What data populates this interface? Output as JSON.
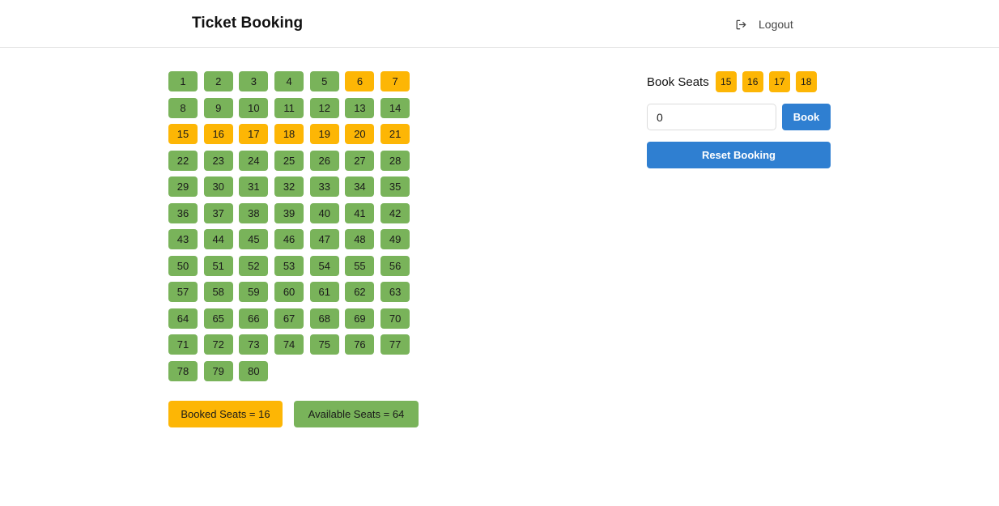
{
  "header": {
    "title": "Ticket Booking",
    "logout_label": "Logout",
    "logout_icon": "logout-icon"
  },
  "seats": [
    {
      "number": "1",
      "status": "available"
    },
    {
      "number": "2",
      "status": "available"
    },
    {
      "number": "3",
      "status": "available"
    },
    {
      "number": "4",
      "status": "available"
    },
    {
      "number": "5",
      "status": "available"
    },
    {
      "number": "6",
      "status": "booked"
    },
    {
      "number": "7",
      "status": "booked"
    },
    {
      "number": "8",
      "status": "available"
    },
    {
      "number": "9",
      "status": "available"
    },
    {
      "number": "10",
      "status": "available"
    },
    {
      "number": "11",
      "status": "available"
    },
    {
      "number": "12",
      "status": "available"
    },
    {
      "number": "13",
      "status": "available"
    },
    {
      "number": "14",
      "status": "available"
    },
    {
      "number": "15",
      "status": "booked"
    },
    {
      "number": "16",
      "status": "booked"
    },
    {
      "number": "17",
      "status": "booked"
    },
    {
      "number": "18",
      "status": "booked"
    },
    {
      "number": "19",
      "status": "booked"
    },
    {
      "number": "20",
      "status": "booked"
    },
    {
      "number": "21",
      "status": "booked"
    },
    {
      "number": "22",
      "status": "available"
    },
    {
      "number": "23",
      "status": "available"
    },
    {
      "number": "24",
      "status": "available"
    },
    {
      "number": "25",
      "status": "available"
    },
    {
      "number": "26",
      "status": "available"
    },
    {
      "number": "27",
      "status": "available"
    },
    {
      "number": "28",
      "status": "available"
    },
    {
      "number": "29",
      "status": "available"
    },
    {
      "number": "30",
      "status": "available"
    },
    {
      "number": "31",
      "status": "available"
    },
    {
      "number": "32",
      "status": "available"
    },
    {
      "number": "33",
      "status": "available"
    },
    {
      "number": "34",
      "status": "available"
    },
    {
      "number": "35",
      "status": "available"
    },
    {
      "number": "36",
      "status": "available"
    },
    {
      "number": "37",
      "status": "available"
    },
    {
      "number": "38",
      "status": "available"
    },
    {
      "number": "39",
      "status": "available"
    },
    {
      "number": "40",
      "status": "available"
    },
    {
      "number": "41",
      "status": "available"
    },
    {
      "number": "42",
      "status": "available"
    },
    {
      "number": "43",
      "status": "available"
    },
    {
      "number": "44",
      "status": "available"
    },
    {
      "number": "45",
      "status": "available"
    },
    {
      "number": "46",
      "status": "available"
    },
    {
      "number": "47",
      "status": "available"
    },
    {
      "number": "48",
      "status": "available"
    },
    {
      "number": "49",
      "status": "available"
    },
    {
      "number": "50",
      "status": "available"
    },
    {
      "number": "51",
      "status": "available"
    },
    {
      "number": "52",
      "status": "available"
    },
    {
      "number": "53",
      "status": "available"
    },
    {
      "number": "54",
      "status": "available"
    },
    {
      "number": "55",
      "status": "available"
    },
    {
      "number": "56",
      "status": "available"
    },
    {
      "number": "57",
      "status": "available"
    },
    {
      "number": "58",
      "status": "available"
    },
    {
      "number": "59",
      "status": "available"
    },
    {
      "number": "60",
      "status": "available"
    },
    {
      "number": "61",
      "status": "available"
    },
    {
      "number": "62",
      "status": "available"
    },
    {
      "number": "63",
      "status": "available"
    },
    {
      "number": "64",
      "status": "available"
    },
    {
      "number": "65",
      "status": "available"
    },
    {
      "number": "66",
      "status": "available"
    },
    {
      "number": "67",
      "status": "available"
    },
    {
      "number": "68",
      "status": "available"
    },
    {
      "number": "69",
      "status": "available"
    },
    {
      "number": "70",
      "status": "available"
    },
    {
      "number": "71",
      "status": "available"
    },
    {
      "number": "72",
      "status": "available"
    },
    {
      "number": "73",
      "status": "available"
    },
    {
      "number": "74",
      "status": "available"
    },
    {
      "number": "75",
      "status": "available"
    },
    {
      "number": "76",
      "status": "available"
    },
    {
      "number": "77",
      "status": "available"
    },
    {
      "number": "78",
      "status": "available"
    },
    {
      "number": "79",
      "status": "available"
    },
    {
      "number": "80",
      "status": "available"
    }
  ],
  "summary": {
    "booked_label": "Booked Seats = 16",
    "available_label": "Available Seats = 64"
  },
  "booking": {
    "label": "Book Seats",
    "selected_seats": [
      "15",
      "16",
      "17",
      "18"
    ],
    "count_value": "0",
    "book_button": "Book",
    "reset_button": "Reset Booking"
  },
  "colors": {
    "available": "#79b35a",
    "booked": "#fdb605",
    "primary": "#2f7fd1"
  }
}
